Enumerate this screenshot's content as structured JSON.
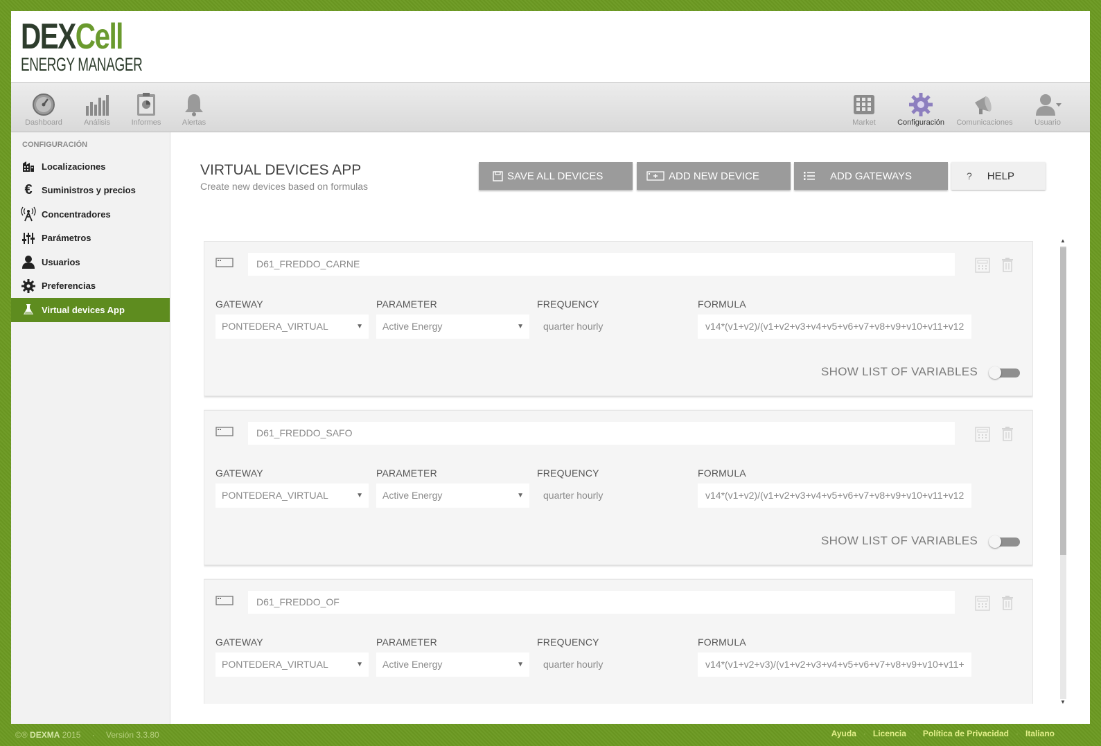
{
  "logo": {
    "line1_a": "DEX",
    "line1_b": "Cell",
    "line2": "ENERGY MANAGER"
  },
  "nav": {
    "left": [
      {
        "label": "Dashboard",
        "icon": "dashboard-gauge-icon"
      },
      {
        "label": "Análisis",
        "icon": "bar-chart-icon"
      },
      {
        "label": "Informes",
        "icon": "clipboard-chart-icon"
      },
      {
        "label": "Alertas",
        "icon": "bell-icon"
      }
    ],
    "right": [
      {
        "label": "Market",
        "icon": "grid-icon"
      },
      {
        "label": "Configuración",
        "icon": "gear-icon"
      },
      {
        "label": "Comunicaciones",
        "icon": "megaphone-icon"
      },
      {
        "label": "Usuario",
        "icon": "user-icon"
      }
    ]
  },
  "sidebar": {
    "title": "CONFIGURACIÓN",
    "items": [
      {
        "label": "Localizaciones",
        "icon": "building-icon"
      },
      {
        "label": "Suministros y precios",
        "icon": "euro-icon"
      },
      {
        "label": "Concentradores",
        "icon": "antenna-icon"
      },
      {
        "label": "Parámetros",
        "icon": "sliders-icon"
      },
      {
        "label": "Usuarios",
        "icon": "user-icon"
      },
      {
        "label": "Preferencias",
        "icon": "gear-icon"
      },
      {
        "label": "Virtual devices App",
        "icon": "flask-icon"
      }
    ]
  },
  "main": {
    "title": "VIRTUAL DEVICES APP",
    "subtitle": "Create new devices based on formulas",
    "buttons": {
      "save": "SAVE ALL DEVICES",
      "add": "ADD NEW DEVICE",
      "gateways": "ADD GATEWAYS",
      "help_icon": "?",
      "help": "HELP"
    },
    "labels": {
      "gateway": "GATEWAY",
      "parameter": "PARAMETER",
      "frequency": "FREQUENCY",
      "formula": "FORMULA",
      "show_vars": "SHOW LIST OF VARIABLES"
    },
    "devices": [
      {
        "name": "D61_FREDDO_CARNE",
        "gateway": "PONTEDERA_VIRTUAL",
        "parameter": "Active Energy",
        "frequency": "quarter hourly",
        "formula": "v14*(v1+v2)/(v1+v2+v3+v4+v5+v6+v7+v8+v9+v10+v11+v12",
        "show_vars": false
      },
      {
        "name": "D61_FREDDO_SAFO",
        "gateway": "PONTEDERA_VIRTUAL",
        "parameter": "Active Energy",
        "frequency": "quarter hourly",
        "formula": "v14*(v1+v2)/(v1+v2+v3+v4+v5+v6+v7+v8+v9+v10+v11+v12",
        "show_vars": false
      },
      {
        "name": "D61_FREDDO_OF",
        "gateway": "PONTEDERA_VIRTUAL",
        "parameter": "Active Energy",
        "frequency": "quarter hourly",
        "formula": "v14*(v1+v2+v3)/(v1+v2+v3+v4+v5+v6+v7+v8+v9+v10+v11+",
        "show_vars": false
      }
    ]
  },
  "footer": {
    "copyright_symbol": "©®",
    "brand": "DEXMA",
    "year": "2015",
    "separator": "·",
    "version": "Versión 3.3.80",
    "links": [
      "Ayuda",
      "Licencia",
      "Política de Privacidad",
      "Italiano"
    ]
  },
  "colors": {
    "accent": "#5e8c1f",
    "background": "#6c9a22",
    "button": "#9b9b9b"
  }
}
